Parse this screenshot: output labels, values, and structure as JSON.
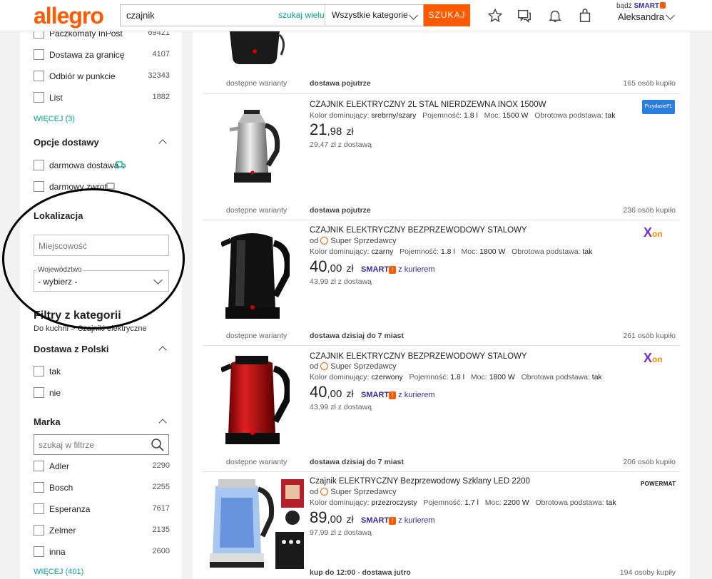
{
  "header": {
    "logo": "allegro",
    "search_value": "czajnik",
    "search_hint": "szukaj wielu",
    "category_select": "Wszystkie kategorie",
    "search_button": "SZUKAJ",
    "smart_prefix": "bądź",
    "smart_word": "SMART",
    "user_name": "Aleksandra",
    "icons": [
      "star-icon",
      "chat-icon",
      "bell-icon",
      "bag-icon"
    ]
  },
  "sidebar": {
    "delivery_methods": [
      {
        "label": "Paczkomaty InPost",
        "count": "69421"
      },
      {
        "label": "Dostawa za granicę",
        "count": "4107"
      },
      {
        "label": "Odbiór w punkcie",
        "count": "32343"
      },
      {
        "label": "List",
        "count": "1882"
      }
    ],
    "delivery_more": "WIĘCEJ (3)",
    "delivery_options_title": "Opcje dostawy",
    "delivery_options": [
      {
        "label": "darmowa dostawa"
      },
      {
        "label": "darmowy zwrot"
      }
    ],
    "location_title": "Lokalizacja",
    "city_placeholder": "Miejscowość",
    "voivodeship_label": "Województwo",
    "voivodeship_value": "- wybierz -",
    "category_filters_title": "Filtry z kategorii",
    "category_path": "Do kuchni > Czajniki elektryczne",
    "from_poland_title": "Dostawa z Polski",
    "from_poland": [
      {
        "label": "tak"
      },
      {
        "label": "nie"
      }
    ],
    "brand_title": "Marka",
    "brand_search_placeholder": "szukaj w filtrze",
    "brands": [
      {
        "label": "Adler",
        "count": "2290"
      },
      {
        "label": "Bosch",
        "count": "2255"
      },
      {
        "label": "Esperanza",
        "count": "7617"
      },
      {
        "label": "Zelmer",
        "count": "2135"
      },
      {
        "label": "inna",
        "count": "2600"
      }
    ],
    "brand_more": "WIĘCEJ (401)"
  },
  "listing": {
    "items": [
      {
        "variant": "dostępne warianty",
        "delivery": "dostawa pojutrze",
        "bought": "165 osób kupiło"
      },
      {
        "title": "CZAJNIK ELEKTRYCZNY 2L STAL NIERDZEWNA INOX 1500W",
        "params": {
          "color_label": "Kolor dominujący:",
          "color": "srebrny/szary",
          "cap_label": "Pojemność:",
          "cap": "1.8 l",
          "power_label": "Moc:",
          "power": "1500 W",
          "base_label": "Obrotowa podstawa:",
          "base": "tak"
        },
        "price_int": "21",
        "price_dec": ",98",
        "currency": "zł",
        "ship_price": "29,47 zł z dostawą",
        "seller_logo": "PrzydasiePL",
        "variant": "dostępne warianty",
        "delivery": "dostawa pojutrze",
        "bought": "236 osób kupiło"
      },
      {
        "title": "CZAJNIK ELEKTRYCZNY BEZPRZEWODOWY STALOWY",
        "seller_prefix": "od",
        "seller": "Super Sprzedawcy",
        "params": {
          "color_label": "Kolor dominujący:",
          "color": "czarny",
          "cap_label": "Pojemność:",
          "cap": "1.8 l",
          "power_label": "Moc:",
          "power": "1800 W",
          "base_label": "Obrotowa podstawa:",
          "base": "tak"
        },
        "price_int": "40",
        "price_dec": ",00",
        "currency": "zł",
        "smart": "SMART",
        "courier": "z kurierem",
        "ship_price": "43,99 zł z dostawą",
        "seller_logo_main": "X",
        "seller_logo_sub": "on",
        "variant": "dostępne warianty",
        "delivery": "dostawa dzisiaj do 7 miast",
        "bought": "261 osób kupiło"
      },
      {
        "title": "CZAJNIK ELEKTRYCZNY BEZPRZEWODOWY STALOWY",
        "seller_prefix": "od",
        "seller": "Super Sprzedawcy",
        "params": {
          "color_label": "Kolor dominujący:",
          "color": "czerwony",
          "cap_label": "Pojemność:",
          "cap": "1.8 l",
          "power_label": "Moc:",
          "power": "1800 W",
          "base_label": "Obrotowa podstawa:",
          "base": "tak"
        },
        "price_int": "40",
        "price_dec": ",00",
        "currency": "zł",
        "smart": "SMART",
        "courier": "z kurierem",
        "ship_price": "43,99 zł z dostawą",
        "seller_logo_main": "X",
        "seller_logo_sub": "on",
        "variant": "dostępne warianty",
        "delivery": "dostawa dzisiaj do 7 miast",
        "bought": "206 osób kupiło"
      },
      {
        "title": "Czajnik ELEKTRYCZNY Bezprzewodowy Szklany LED 2200",
        "seller_prefix": "od",
        "seller": "Super Sprzedawcy",
        "params": {
          "color_label": "Kolor dominujący:",
          "color": "przezroczysty",
          "cap_label": "Pojemność:",
          "cap": "1.7 l",
          "power_label": "Moc:",
          "power": "2200 W",
          "base_label": "Obrotowa podstawa:",
          "base": "tak"
        },
        "price_int": "89",
        "price_dec": ",00",
        "currency": "zł",
        "smart": "SMART",
        "courier": "z kurierem",
        "ship_price": "97,99 zł z dostawą",
        "seller_logo": "POWERMAT",
        "delivery": "kup do 12:00 - dostawa jutro",
        "bought": "194 osoby kupiły"
      }
    ]
  },
  "colors": {
    "brand": "#ff5a00",
    "link": "#00a790",
    "smart": "#3b2aa7"
  }
}
